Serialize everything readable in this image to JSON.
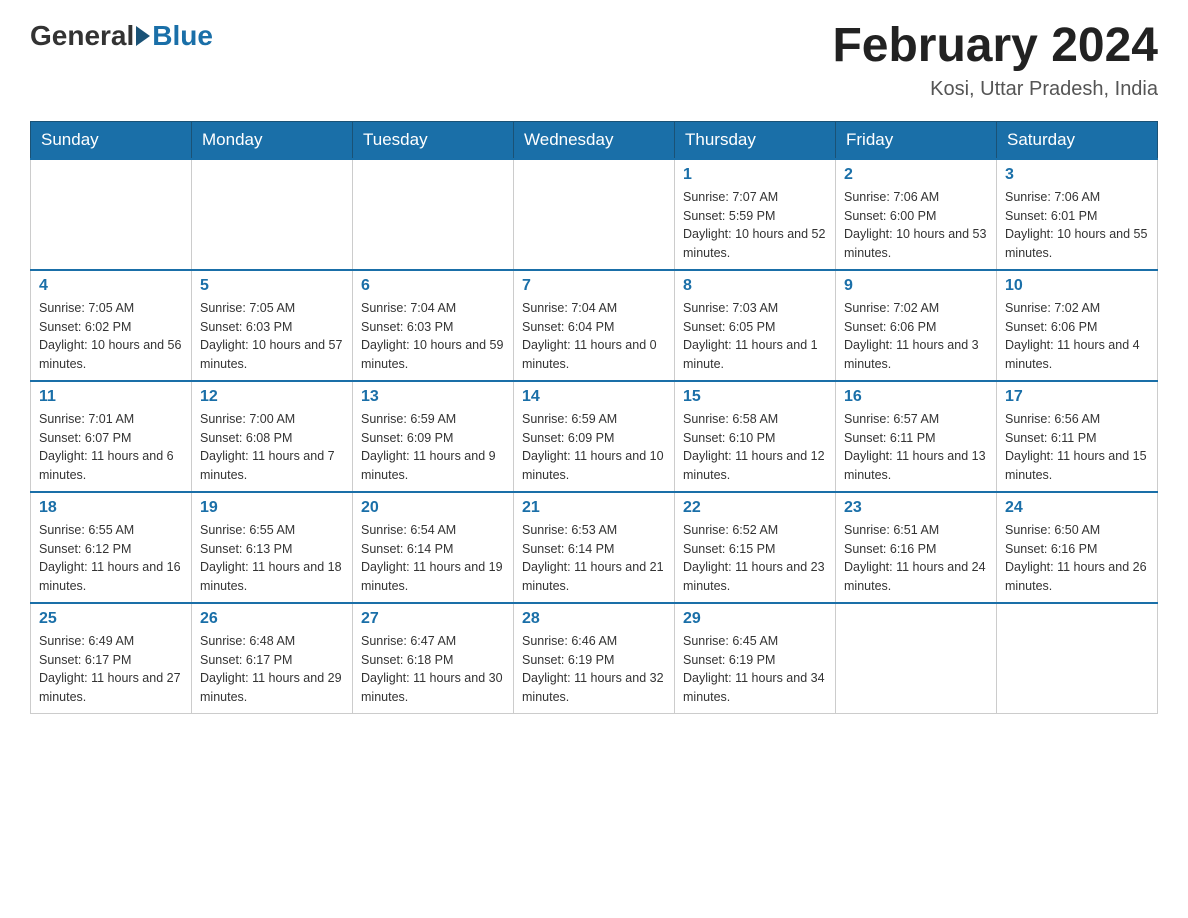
{
  "header": {
    "logo_general": "General",
    "logo_blue": "Blue",
    "month_title": "February 2024",
    "location": "Kosi, Uttar Pradesh, India"
  },
  "days_of_week": [
    "Sunday",
    "Monday",
    "Tuesday",
    "Wednesday",
    "Thursday",
    "Friday",
    "Saturday"
  ],
  "weeks": [
    [
      {
        "day": "",
        "info": ""
      },
      {
        "day": "",
        "info": ""
      },
      {
        "day": "",
        "info": ""
      },
      {
        "day": "",
        "info": ""
      },
      {
        "day": "1",
        "info": "Sunrise: 7:07 AM\nSunset: 5:59 PM\nDaylight: 10 hours and 52 minutes."
      },
      {
        "day": "2",
        "info": "Sunrise: 7:06 AM\nSunset: 6:00 PM\nDaylight: 10 hours and 53 minutes."
      },
      {
        "day": "3",
        "info": "Sunrise: 7:06 AM\nSunset: 6:01 PM\nDaylight: 10 hours and 55 minutes."
      }
    ],
    [
      {
        "day": "4",
        "info": "Sunrise: 7:05 AM\nSunset: 6:02 PM\nDaylight: 10 hours and 56 minutes."
      },
      {
        "day": "5",
        "info": "Sunrise: 7:05 AM\nSunset: 6:03 PM\nDaylight: 10 hours and 57 minutes."
      },
      {
        "day": "6",
        "info": "Sunrise: 7:04 AM\nSunset: 6:03 PM\nDaylight: 10 hours and 59 minutes."
      },
      {
        "day": "7",
        "info": "Sunrise: 7:04 AM\nSunset: 6:04 PM\nDaylight: 11 hours and 0 minutes."
      },
      {
        "day": "8",
        "info": "Sunrise: 7:03 AM\nSunset: 6:05 PM\nDaylight: 11 hours and 1 minute."
      },
      {
        "day": "9",
        "info": "Sunrise: 7:02 AM\nSunset: 6:06 PM\nDaylight: 11 hours and 3 minutes."
      },
      {
        "day": "10",
        "info": "Sunrise: 7:02 AM\nSunset: 6:06 PM\nDaylight: 11 hours and 4 minutes."
      }
    ],
    [
      {
        "day": "11",
        "info": "Sunrise: 7:01 AM\nSunset: 6:07 PM\nDaylight: 11 hours and 6 minutes."
      },
      {
        "day": "12",
        "info": "Sunrise: 7:00 AM\nSunset: 6:08 PM\nDaylight: 11 hours and 7 minutes."
      },
      {
        "day": "13",
        "info": "Sunrise: 6:59 AM\nSunset: 6:09 PM\nDaylight: 11 hours and 9 minutes."
      },
      {
        "day": "14",
        "info": "Sunrise: 6:59 AM\nSunset: 6:09 PM\nDaylight: 11 hours and 10 minutes."
      },
      {
        "day": "15",
        "info": "Sunrise: 6:58 AM\nSunset: 6:10 PM\nDaylight: 11 hours and 12 minutes."
      },
      {
        "day": "16",
        "info": "Sunrise: 6:57 AM\nSunset: 6:11 PM\nDaylight: 11 hours and 13 minutes."
      },
      {
        "day": "17",
        "info": "Sunrise: 6:56 AM\nSunset: 6:11 PM\nDaylight: 11 hours and 15 minutes."
      }
    ],
    [
      {
        "day": "18",
        "info": "Sunrise: 6:55 AM\nSunset: 6:12 PM\nDaylight: 11 hours and 16 minutes."
      },
      {
        "day": "19",
        "info": "Sunrise: 6:55 AM\nSunset: 6:13 PM\nDaylight: 11 hours and 18 minutes."
      },
      {
        "day": "20",
        "info": "Sunrise: 6:54 AM\nSunset: 6:14 PM\nDaylight: 11 hours and 19 minutes."
      },
      {
        "day": "21",
        "info": "Sunrise: 6:53 AM\nSunset: 6:14 PM\nDaylight: 11 hours and 21 minutes."
      },
      {
        "day": "22",
        "info": "Sunrise: 6:52 AM\nSunset: 6:15 PM\nDaylight: 11 hours and 23 minutes."
      },
      {
        "day": "23",
        "info": "Sunrise: 6:51 AM\nSunset: 6:16 PM\nDaylight: 11 hours and 24 minutes."
      },
      {
        "day": "24",
        "info": "Sunrise: 6:50 AM\nSunset: 6:16 PM\nDaylight: 11 hours and 26 minutes."
      }
    ],
    [
      {
        "day": "25",
        "info": "Sunrise: 6:49 AM\nSunset: 6:17 PM\nDaylight: 11 hours and 27 minutes."
      },
      {
        "day": "26",
        "info": "Sunrise: 6:48 AM\nSunset: 6:17 PM\nDaylight: 11 hours and 29 minutes."
      },
      {
        "day": "27",
        "info": "Sunrise: 6:47 AM\nSunset: 6:18 PM\nDaylight: 11 hours and 30 minutes."
      },
      {
        "day": "28",
        "info": "Sunrise: 6:46 AM\nSunset: 6:19 PM\nDaylight: 11 hours and 32 minutes."
      },
      {
        "day": "29",
        "info": "Sunrise: 6:45 AM\nSunset: 6:19 PM\nDaylight: 11 hours and 34 minutes."
      },
      {
        "day": "",
        "info": ""
      },
      {
        "day": "",
        "info": ""
      }
    ]
  ]
}
